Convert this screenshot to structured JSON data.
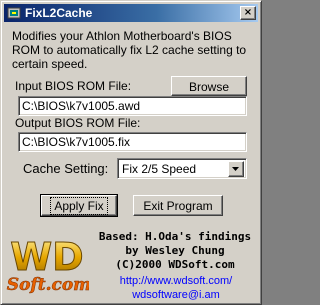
{
  "window": {
    "title": "FixL2Cache",
    "close_glyph": "×"
  },
  "description": "Modifies your Athlon Motherboard's BIOS ROM to automatically fix L2 cache setting to certain speed.",
  "input_file": {
    "label": "Input BIOS ROM File:",
    "value": "C:\\BIOS\\k7v1005.awd",
    "browse_label": "Browse"
  },
  "output_file": {
    "label": "Output BIOS ROM File:",
    "value": "C:\\BIOS\\k7v1005.fix"
  },
  "cache_setting": {
    "label": "Cache Setting:",
    "selected": "Fix 2/5 Speed"
  },
  "buttons": {
    "apply": "Apply Fix",
    "exit": "Exit Program"
  },
  "logo": {
    "text_top": "WD",
    "text_bottom": "Soft.com"
  },
  "credits": {
    "line1": "Based: H.Oda's findings",
    "line2": "by Wesley Chung",
    "line3": "(C)2000 WDSoft.com"
  },
  "links": {
    "website": "http://www.wdsoft.com/",
    "email": "wdsoftware@i.am"
  },
  "colors": {
    "face": "#d4d0c8",
    "title_active": "#0a246a",
    "link": "#0000ff",
    "logo_gold": "#e8a800"
  }
}
